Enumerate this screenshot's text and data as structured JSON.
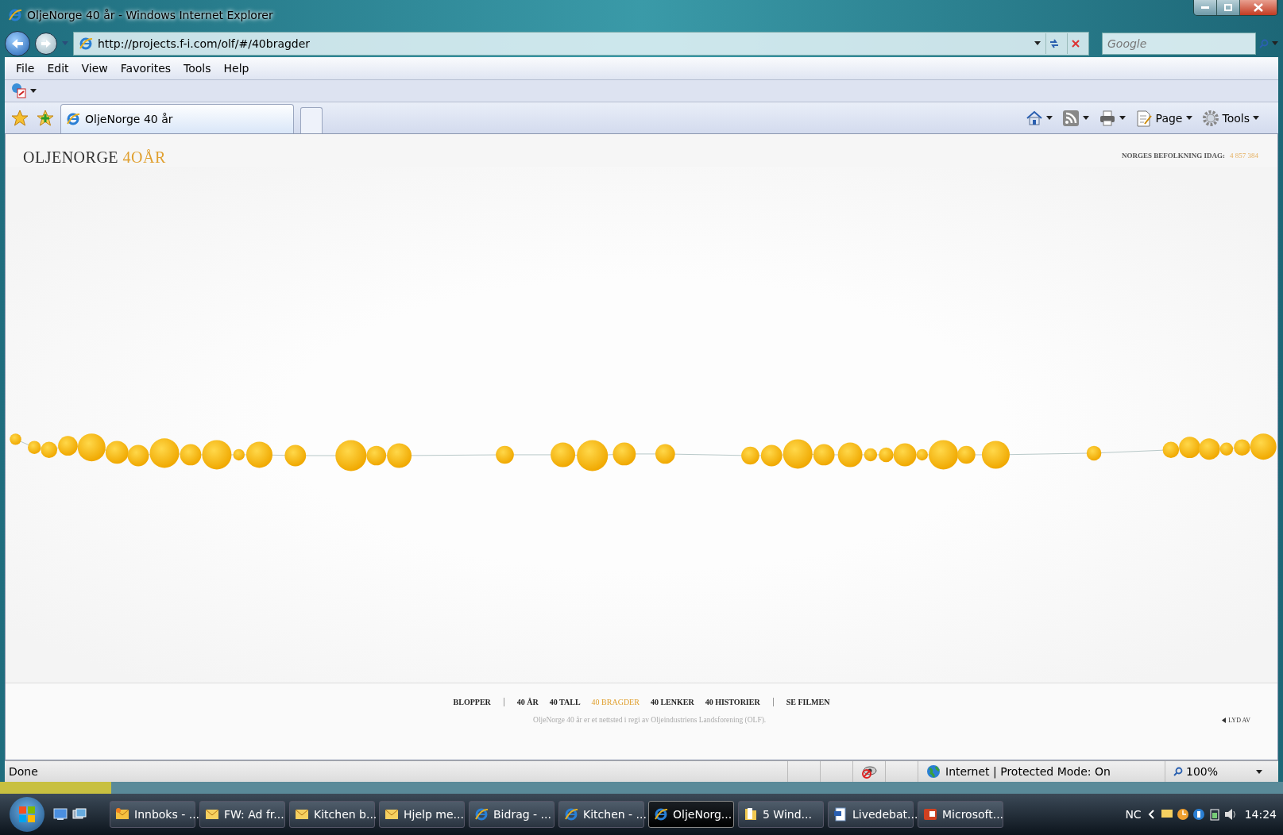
{
  "window": {
    "title": "OljeNorge 40 år - Windows Internet Explorer"
  },
  "address_bar": {
    "url": "http://projects.f-i.com/olf/#/40bragder"
  },
  "search": {
    "placeholder": "Google"
  },
  "menu": [
    "File",
    "Edit",
    "View",
    "Favorites",
    "Tools",
    "Help"
  ],
  "tabs": [
    {
      "label": "OljeNorge 40 år",
      "selected": true
    }
  ],
  "command_bar": [
    {
      "kind": "home"
    },
    {
      "kind": "feed"
    },
    {
      "kind": "print"
    },
    {
      "kind": "page",
      "label": "Page"
    },
    {
      "kind": "tools",
      "label": "Tools"
    }
  ],
  "page": {
    "logo": {
      "name": "OLJENORGE",
      "accent": "4OÅR"
    },
    "population": {
      "label": "NORGES BEFOLKNING IDAG:",
      "value": "4 857 384"
    },
    "nav_groups": [
      [
        {
          "label": "BLOPPER",
          "selected": false
        }
      ],
      [
        {
          "label": "40 ÅR",
          "selected": false
        },
        {
          "label": "40 TALL",
          "selected": false
        },
        {
          "label": "40 BRAGDER",
          "selected": true
        },
        {
          "label": "40 LENKER",
          "selected": false
        },
        {
          "label": "40 HISTORIER",
          "selected": false
        }
      ],
      [
        {
          "label": "SE FILMEN",
          "selected": false
        }
      ]
    ],
    "credit": "OljeNorge 40 år er et nettsted i regi av Oljeindustriens Landsforening (OLF).",
    "sound": "LYD AV"
  },
  "status_bar": {
    "text": "Done",
    "zone": "Internet | Protected Mode: On",
    "zoom": "100%"
  },
  "taskbar": {
    "items": [
      {
        "kind": "outlook",
        "label": "Innboks - ...",
        "selected": false
      },
      {
        "kind": "mail",
        "label": "FW: Ad fr...",
        "selected": false
      },
      {
        "kind": "mail",
        "label": "Kitchen b...",
        "selected": false
      },
      {
        "kind": "mail",
        "label": "Hjelp me...",
        "selected": false
      },
      {
        "kind": "browser",
        "label": "Bidrag - ...",
        "selected": false
      },
      {
        "kind": "browser",
        "label": "Kitchen - ...",
        "selected": false
      },
      {
        "kind": "browser",
        "label": "OljeNorg...",
        "selected": true
      },
      {
        "kind": "folder",
        "label": "5 Wind...",
        "selected": false
      },
      {
        "kind": "document",
        "label": "Livedebat...",
        "selected": false
      },
      {
        "kind": "presentation",
        "label": "Microsoft...",
        "selected": false
      }
    ],
    "language": "NC",
    "clock": "14:24"
  }
}
